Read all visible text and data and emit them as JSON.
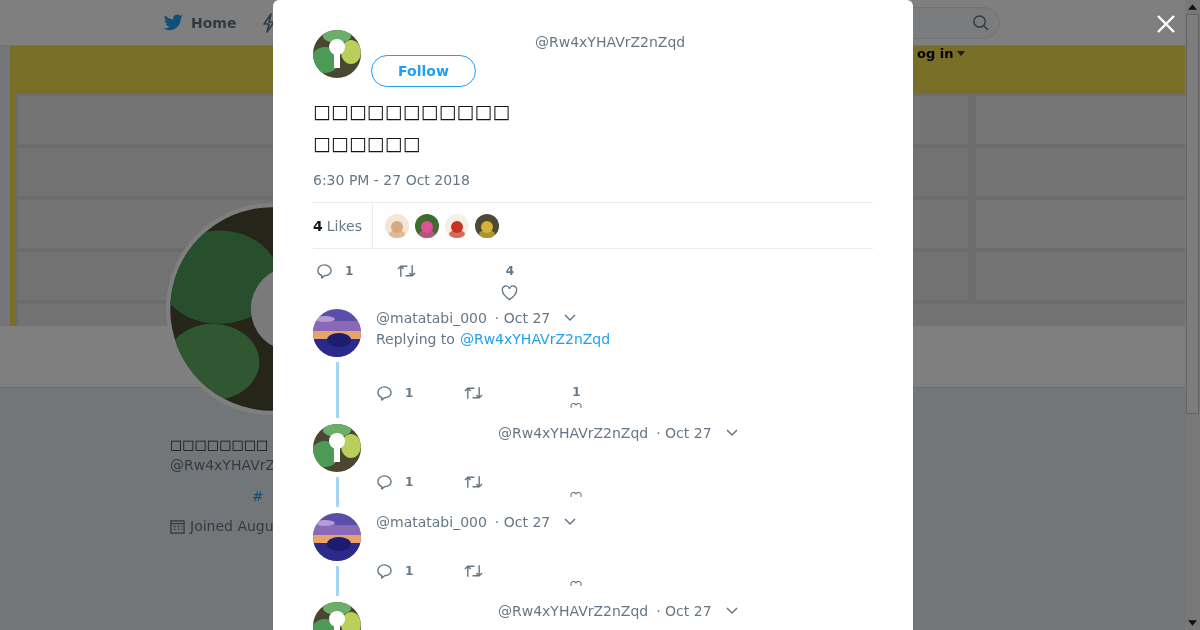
{
  "nav": {
    "home_label": "Home",
    "login_label": "og in"
  },
  "profile": {
    "name": "□□□□□□□□",
    "handle": "@Rw4xYHAVrZ",
    "hashtag": "#",
    "joined": "Joined Augu"
  },
  "tweet": {
    "handle": "@Rw4xYHAVrZ2nZqd",
    "follow_label": "Follow",
    "text": "□□□□□□□□□□□□□□□□□",
    "timestamp": "6:30 PM - 27 Oct 2018",
    "likes": "**4** Likes",
    "likers": [
      {
        "kind": "portrait"
      },
      {
        "kind": "flower"
      },
      {
        "kind": "seal"
      },
      {
        "kind": "emblem"
      }
    ],
    "reply_count": "1",
    "like_count": "4"
  },
  "replies": [
    {
      "kind": "other",
      "handle": "@matatabi_000",
      "date": "· Oct 27",
      "replying_to": "Replying to",
      "replying_handle": "@Rw4xYHAVrZ2nZqd",
      "reply_count": "1",
      "like_count": "1"
    },
    {
      "kind": "author",
      "handle": "@Rw4xYHAVrZ2nZqd",
      "date": "· Oct 27",
      "reply_count": "1"
    },
    {
      "kind": "other",
      "handle": "@matatabi_000",
      "date": "· Oct 27",
      "reply_count": "1"
    },
    {
      "kind": "author",
      "handle": "@Rw4xYHAVrZ2nZqd",
      "date": "· Oct 27"
    }
  ]
}
